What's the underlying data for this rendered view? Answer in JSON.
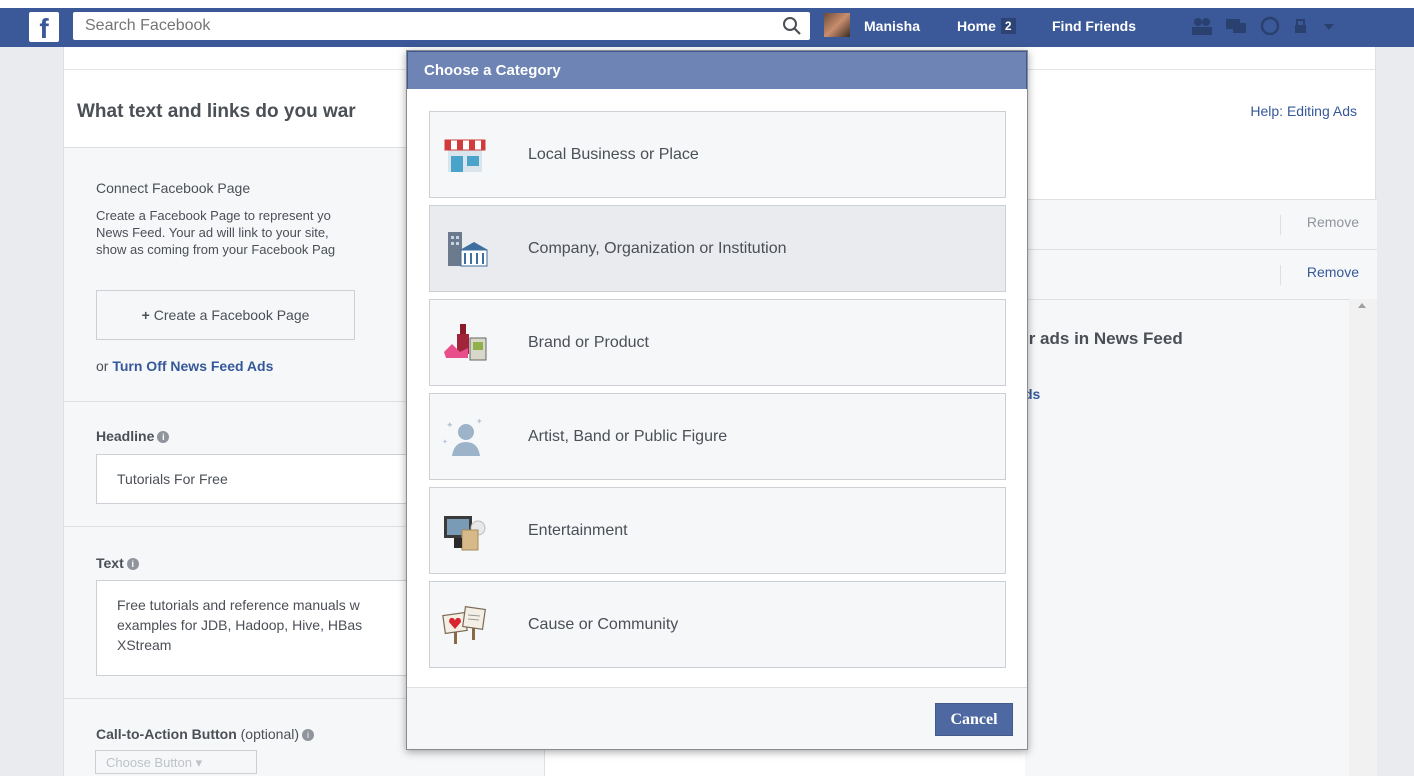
{
  "topbar": {
    "logo": "f",
    "search_placeholder": "Search Facebook",
    "user_name": "Manisha",
    "home_label": "Home",
    "home_count": "2",
    "find_friends_label": "Find Friends"
  },
  "page": {
    "question": "What text and links do you war",
    "help_link": "Help: Editing Ads",
    "connect_title": "Connect Facebook Page",
    "connect_desc_lines": [
      "Create a Facebook Page to represent yo",
      "News Feed. Your ad will link to your site,",
      "show as coming from your Facebook Pag"
    ],
    "create_page_plus": "+",
    "create_page_label": "Create a Facebook Page",
    "or_label": "or",
    "turn_off_link": "Turn Off News Feed Ads",
    "headline_label": "Headline",
    "headline_value": "Tutorials For Free",
    "text_label": "Text",
    "text_value_lines": [
      "Free tutorials and reference manuals w",
      "examples for JDB, Hadoop, Hive, HBas",
      "XStream"
    ],
    "cta_label": "Call-to-Action Button",
    "cta_optional": "(optional)",
    "choose_button": "Choose Button",
    "remove_1": "Remove",
    "remove_2": "Remove",
    "preview_title": "ır ads in News Feed",
    "preview_link": "ds"
  },
  "modal": {
    "title": "Choose a Category",
    "categories": [
      {
        "label": "Local Business or Place",
        "icon": "storefront-icon"
      },
      {
        "label": "Company, Organization or Institution",
        "icon": "building-icon"
      },
      {
        "label": "Brand or Product",
        "icon": "products-icon"
      },
      {
        "label": "Artist, Band or Public Figure",
        "icon": "person-silhouette-icon"
      },
      {
        "label": "Entertainment",
        "icon": "tv-icon"
      },
      {
        "label": "Cause or Community",
        "icon": "signs-icon"
      }
    ],
    "cancel_label": "Cancel"
  },
  "colors": {
    "brand_blue": "#3b5998",
    "modal_header": "#6d84b4",
    "link_blue": "#365899"
  }
}
